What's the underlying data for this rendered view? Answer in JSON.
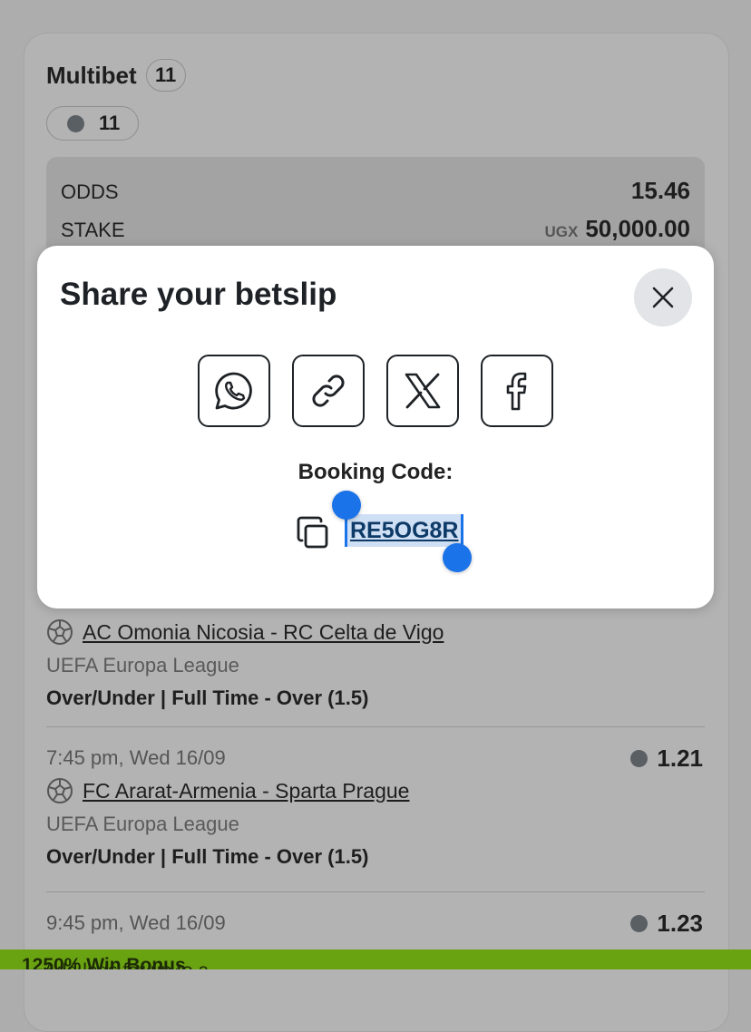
{
  "betslip": {
    "title": "Multibet",
    "selection_count": "11",
    "chip_count": "11",
    "summary": {
      "odds_label": "ODDS",
      "odds_value": "15.46",
      "stake_label": "STAKE",
      "currency": "UGX",
      "stake_value": "50,000.00"
    },
    "events": [
      {
        "teams": "AC Omonia Nicosia - RC Celta de Vigo",
        "league": "UEFA Europa League",
        "market": "Over/Under | Full Time - Over (1.5)"
      },
      {
        "time": "7:45 pm, Wed 16/09",
        "odds": "1.21",
        "teams": "FC Ararat-Armenia - Sparta Prague",
        "league": "UEFA Europa League",
        "market": "Over/Under | Full Time - Over (1.5)"
      },
      {
        "time": "9:45 pm, Wed 16/09",
        "odds": "1.23"
      }
    ]
  },
  "banner": {
    "text_prefix": "Add legs for up to a ",
    "text_bold": "1250% Win Bonus"
  },
  "share_modal": {
    "title": "Share your betslip",
    "share_options": [
      "whatsapp-icon",
      "link-icon",
      "x-icon",
      "facebook-icon"
    ],
    "booking_code_label": "Booking Code:",
    "booking_code": "RE5OG8R"
  },
  "colors": {
    "accent_blue": "#1a73e8",
    "banner_green": "#6aa312",
    "overlay": "#adadad"
  }
}
